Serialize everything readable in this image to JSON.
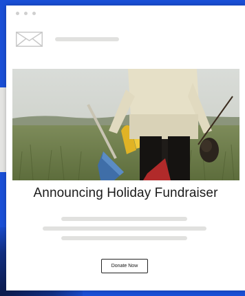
{
  "email": {
    "headline": "Announcing Holiday Fundraiser",
    "cta_label": "Donate Now",
    "icon": "envelope-icon",
    "photo_subject": "person-carrying-shovel-and-gloves-in-grass-field"
  },
  "colors": {
    "background": "#1a4fd6",
    "card": "#ffffff",
    "placeholder": "#e1e1df",
    "text": "#1a1a1a"
  }
}
